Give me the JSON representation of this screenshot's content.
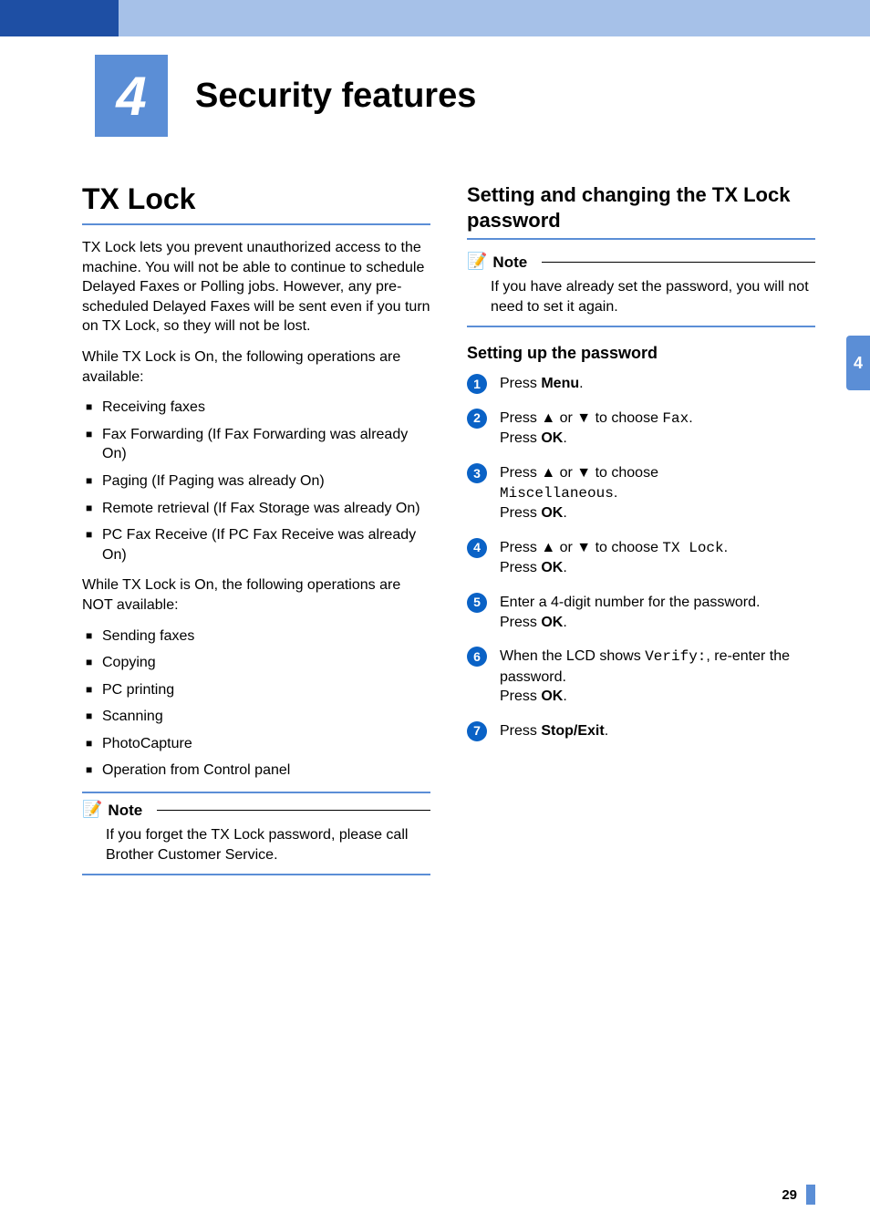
{
  "chapter": {
    "number": "4",
    "title": "Security features"
  },
  "tab": "4",
  "pageNumber": "29",
  "left": {
    "heading": "TX Lock",
    "intro1": "TX Lock lets you prevent unauthorized access to the machine. You will not be able to continue to schedule Delayed Faxes or Polling jobs. However, any pre-scheduled Delayed Faxes will be sent even if you turn on TX Lock, so they will not be lost.",
    "intro2": "While TX Lock is On, the following operations are available:",
    "availList": [
      "Receiving faxes",
      "Fax Forwarding (If Fax Forwarding was already On)",
      "Paging (If Paging was already On)",
      "Remote retrieval (If Fax Storage was already On)",
      "PC Fax Receive (If PC Fax Receive was already On)"
    ],
    "intro3": "While TX Lock is On, the following operations are NOT available:",
    "notAvailList": [
      "Sending faxes",
      "Copying",
      "PC printing",
      "Scanning",
      "PhotoCapture",
      "Operation from Control panel"
    ],
    "note": {
      "label": "Note",
      "text": "If you forget the TX Lock password, please call Brother Customer Service."
    }
  },
  "right": {
    "heading": "Setting and changing the TX Lock password",
    "note": {
      "label": "Note",
      "text": "If you have already set the password, you will not need to set it again."
    },
    "sub": "Setting up the password",
    "steps": {
      "s1": {
        "pre": "Press ",
        "bold": "Menu",
        "post": "."
      },
      "s2": {
        "t1": "Press ▲ or ▼ to choose ",
        "code": "Fax",
        "t2": ".",
        "line2a": "Press ",
        "bold2": "OK",
        "line2b": "."
      },
      "s3": {
        "t1": "Press ▲ or ▼ to choose ",
        "code": "Miscellaneous",
        "t2": ".",
        "line2a": "Press ",
        "bold2": "OK",
        "line2b": "."
      },
      "s4": {
        "t1": "Press ▲ or ▼ to choose ",
        "code": "TX Lock",
        "t2": ".",
        "line2a": "Press ",
        "bold2": "OK",
        "line2b": "."
      },
      "s5": {
        "t1": "Enter a 4-digit number for the password.",
        "line2a": "Press ",
        "bold2": "OK",
        "line2b": "."
      },
      "s6": {
        "t1": "When the LCD shows ",
        "code": "Verify:",
        "t2": ", re-enter the password.",
        "line2a": "Press ",
        "bold2": "OK",
        "line2b": "."
      },
      "s7": {
        "pre": "Press ",
        "bold": "Stop/Exit",
        "post": "."
      }
    }
  }
}
